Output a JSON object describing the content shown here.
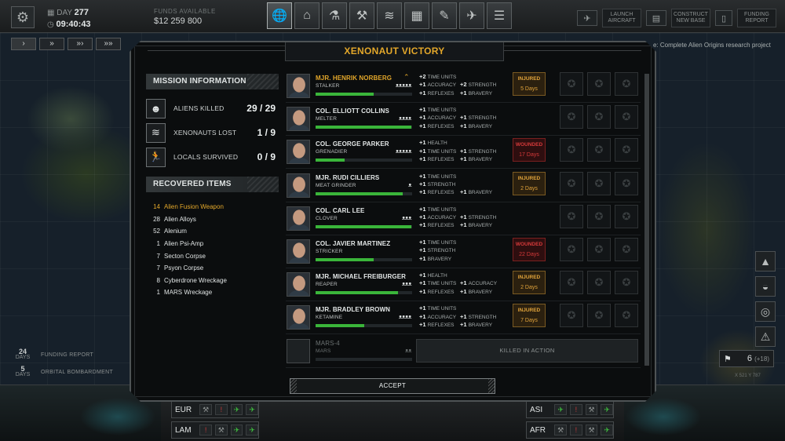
{
  "topbar": {
    "day_label": "DAY",
    "day_value": "277",
    "time": "09:40:43",
    "funds_label": "FUNDS AVAILABLE",
    "funds_value": "$12 259 800",
    "nav_icons": [
      "geoscape-icon",
      "hangar-icon",
      "research-icon",
      "engineering-icon",
      "soldiers-icon",
      "base-icon",
      "armory-icon",
      "aircraft-icon",
      "xenopedia-icon"
    ],
    "launch_aircraft": "LAUNCH AIRCRAFT",
    "construct_base": "CONSTRUCT NEW BASE",
    "funding_report": "FUNDING REPORT"
  },
  "objective_text": "e: Complete Alien Origins research project",
  "events": [
    {
      "days": "24",
      "unit": "DAYS",
      "label": "FUNDING REPORT"
    },
    {
      "days": "5",
      "unit": "DAYS",
      "label": "ORBITAL BOMBARDMENT"
    }
  ],
  "aircraft_count": "6",
  "aircraft_extra": "(+18)",
  "coords": "X 521   Y 787",
  "regions_left": [
    {
      "code": "EUR",
      "icons": [
        "wrench",
        "alert",
        "plane",
        "plane"
      ]
    },
    {
      "code": "LAM",
      "icons": [
        "alert",
        "wrench",
        "plane",
        "plane"
      ]
    }
  ],
  "regions_right": [
    {
      "code": "ASI",
      "icons": [
        "plane",
        "alert",
        "wrench",
        "plane"
      ]
    },
    {
      "code": "AFR",
      "icons": [
        "wrench",
        "alert",
        "wrench",
        "plane"
      ]
    }
  ],
  "modal": {
    "title": "XENONAUT VICTORY",
    "mission_header": "MISSION INFORMATION",
    "stats": [
      {
        "label": "ALIENS KILLED",
        "value": "29 / 29",
        "icon": "alien-icon"
      },
      {
        "label": "XENONAUTS LOST",
        "value": "1 / 9",
        "icon": "rank-chevron-icon"
      },
      {
        "label": "LOCALS SURVIVED",
        "value": "0 / 9",
        "icon": "running-person-icon"
      }
    ],
    "items_header": "RECOVERED ITEMS",
    "items": [
      {
        "qty": "14",
        "name": "Alien Fusion Weapon"
      },
      {
        "qty": "28",
        "name": "Alien Alloys"
      },
      {
        "qty": "52",
        "name": "Alenium"
      },
      {
        "qty": "1",
        "name": "Alien Psi-Amp"
      },
      {
        "qty": "7",
        "name": "Secton Corpse"
      },
      {
        "qty": "7",
        "name": "Psyon Corpse"
      },
      {
        "qty": "8",
        "name": "Cyberdrone Wreckage"
      },
      {
        "qty": "1",
        "name": "MARS Wreckage"
      }
    ],
    "soldiers": [
      {
        "name": "MJR. HENRIK NORBERG",
        "callsign": "STALKER",
        "medals": "ᴥᴥᴥᴥᴥ",
        "xp": 0.6,
        "promoted": true,
        "stats": [
          {
            "v": "+2",
            "l": "TIME UNITS"
          },
          {
            "v": "+1",
            "l": "ACCURACY"
          },
          {
            "v": "+2",
            "l": "STRENGTH"
          },
          {
            "v": "+1",
            "l": "REFLEXES"
          },
          {
            "v": "+1",
            "l": "BRAVERY"
          }
        ],
        "status": "INJURED",
        "days": "5 Days",
        "status_kind": "injured"
      },
      {
        "name": "COL. ELLIOTT COLLINS",
        "callsign": "MELTER",
        "medals": "ᴥᴥᴥᴥ",
        "xp": 0.99,
        "promoted": false,
        "stats": [
          {
            "v": "+1",
            "l": "TIME UNITS"
          },
          {
            "v": "+1",
            "l": "ACCURACY"
          },
          {
            "v": "+1",
            "l": "STRENGTH"
          },
          {
            "v": "+1",
            "l": "REFLEXES"
          },
          {
            "v": "+1",
            "l": "BRAVERY"
          }
        ],
        "status": "",
        "days": "",
        "status_kind": "none"
      },
      {
        "name": "COL. GEORGE PARKER",
        "callsign": "GRENADIER",
        "medals": "ᴥᴥᴥᴥᴥ",
        "xp": 0.3,
        "promoted": false,
        "stats": [
          {
            "v": "+1",
            "l": "HEALTH"
          },
          {
            "v": "+1",
            "l": "TIME UNITS"
          },
          {
            "v": "+1",
            "l": "STRENGTH"
          },
          {
            "v": "+1",
            "l": "REFLEXES"
          },
          {
            "v": "+1",
            "l": "BRAVERY"
          }
        ],
        "status": "WOUNDED",
        "days": "17 Days",
        "status_kind": "wounded"
      },
      {
        "name": "MJR. RUDI CILLIERS",
        "callsign": "MEAT GRINDER",
        "medals": "ᴥ",
        "xp": 0.9,
        "promoted": false,
        "stats": [
          {
            "v": "+1",
            "l": "TIME UNITS"
          },
          {
            "v": "+1",
            "l": "STRENGTH"
          },
          {
            "v": "+1",
            "l": "REFLEXES"
          },
          {
            "v": "+1",
            "l": "BRAVERY"
          }
        ],
        "status": "INJURED",
        "days": "2 Days",
        "status_kind": "injured"
      },
      {
        "name": "COL. CARL LEE",
        "callsign": "CLOVER",
        "medals": "ᴥᴥᴥ",
        "xp": 0.99,
        "promoted": false,
        "stats": [
          {
            "v": "+1",
            "l": "TIME UNITS"
          },
          {
            "v": "+1",
            "l": "ACCURACY"
          },
          {
            "v": "+1",
            "l": "STRENGTH"
          },
          {
            "v": "+1",
            "l": "REFLEXES"
          },
          {
            "v": "+1",
            "l": "BRAVERY"
          }
        ],
        "status": "",
        "days": "",
        "status_kind": "none"
      },
      {
        "name": "COL. JAVIER MARTINEZ",
        "callsign": "STRICKER",
        "medals": "",
        "xp": 0.6,
        "promoted": false,
        "stats": [
          {
            "v": "+1",
            "l": "TIME UNITS"
          },
          {
            "v": "+1",
            "l": "STRENGTH"
          },
          {
            "v": "+1",
            "l": "BRAVERY"
          }
        ],
        "status": "WOUNDED",
        "days": "22 Days",
        "status_kind": "wounded"
      },
      {
        "name": "MJR. MICHAEL FREIBURGER",
        "callsign": "REAPER",
        "medals": "ᴥᴥᴥ",
        "xp": 0.85,
        "promoted": false,
        "stats": [
          {
            "v": "+1",
            "l": "HEALTH"
          },
          {
            "v": "+1",
            "l": "TIME UNITS"
          },
          {
            "v": "+1",
            "l": "ACCURACY"
          },
          {
            "v": "+1",
            "l": "REFLEXES"
          },
          {
            "v": "+1",
            "l": "BRAVERY"
          }
        ],
        "status": "INJURED",
        "days": "2 Days",
        "status_kind": "injured"
      },
      {
        "name": "MJR. BRADLEY BROWN",
        "callsign": "KETAMINE",
        "medals": "ᴥᴥᴥᴥ",
        "xp": 0.5,
        "promoted": false,
        "stats": [
          {
            "v": "+1",
            "l": "TIME UNITS"
          },
          {
            "v": "+1",
            "l": "ACCURACY"
          },
          {
            "v": "+1",
            "l": "STRENGTH"
          },
          {
            "v": "+1",
            "l": "REFLEXES"
          },
          {
            "v": "+1",
            "l": "BRAVERY"
          }
        ],
        "status": "INJURED",
        "days": "7 Days",
        "status_kind": "injured"
      }
    ],
    "dead": {
      "name": "MARS-4",
      "callsign": "MARS",
      "medals": "ᴥᴥ",
      "kia_label": "KILLED IN ACTION"
    },
    "accept_label": "ACCEPT"
  }
}
